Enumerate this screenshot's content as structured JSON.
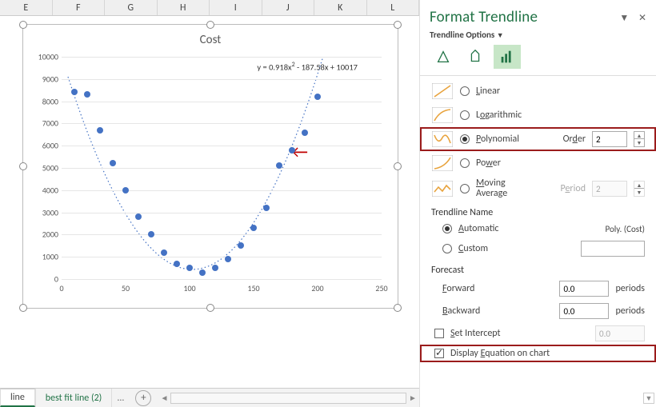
{
  "columns": [
    "E",
    "F",
    "G",
    "H",
    "I",
    "J",
    "K",
    "L"
  ],
  "chart": {
    "title": "Cost",
    "equation_pre": "y = 0.918x",
    "equation_post": " - 187.58x + 10017"
  },
  "chart_data": {
    "type": "scatter",
    "title": "Cost",
    "xlabel": "",
    "ylabel": "",
    "xlim": [
      0,
      250
    ],
    "ylim": [
      0,
      10000
    ],
    "xticks": [
      0,
      50,
      100,
      150,
      200,
      250
    ],
    "yticks": [
      0,
      1000,
      2000,
      3000,
      4000,
      5000,
      6000,
      7000,
      8000,
      9000,
      10000
    ],
    "series": [
      {
        "name": "Cost",
        "x": [
          10,
          20,
          30,
          40,
          50,
          60,
          70,
          80,
          90,
          100,
          110,
          120,
          130,
          140,
          150,
          160,
          170,
          180,
          190,
          200
        ],
        "y": [
          8400,
          8300,
          6700,
          5200,
          4000,
          2800,
          2000,
          1200,
          700,
          500,
          300,
          500,
          900,
          1500,
          2300,
          3200,
          5100,
          5800,
          6600,
          8200
        ]
      }
    ],
    "trendline": {
      "type": "polynomial",
      "order": 2,
      "equation": "y = 0.918x^2 - 187.58x + 10017"
    }
  },
  "tabs": {
    "active": "line",
    "items": [
      "line",
      "best fit line (2)"
    ],
    "overflow": "..."
  },
  "pane": {
    "title": "Format Trendline",
    "sub": "Trendline Options",
    "types": {
      "linear": "Linear",
      "log": "Logarithmic",
      "poly": "Polynomial",
      "power": "Power",
      "mavg1": "Moving",
      "mavg2": "Average"
    },
    "order_label": "Order",
    "order_value": "2",
    "period_label": "Period",
    "period_value": "2",
    "tname": "Trendline Name",
    "auto": "Automatic",
    "auto_val": "Poly. (Cost)",
    "custom": "Custom",
    "forecast": "Forecast",
    "forward": "Forward",
    "backward": "Backward",
    "periods": "periods",
    "f_val": "0.0",
    "b_val": "0.0",
    "set_int": "Set Intercept",
    "int_val": "0.0",
    "disp_eq": "Display Equation on chart"
  }
}
